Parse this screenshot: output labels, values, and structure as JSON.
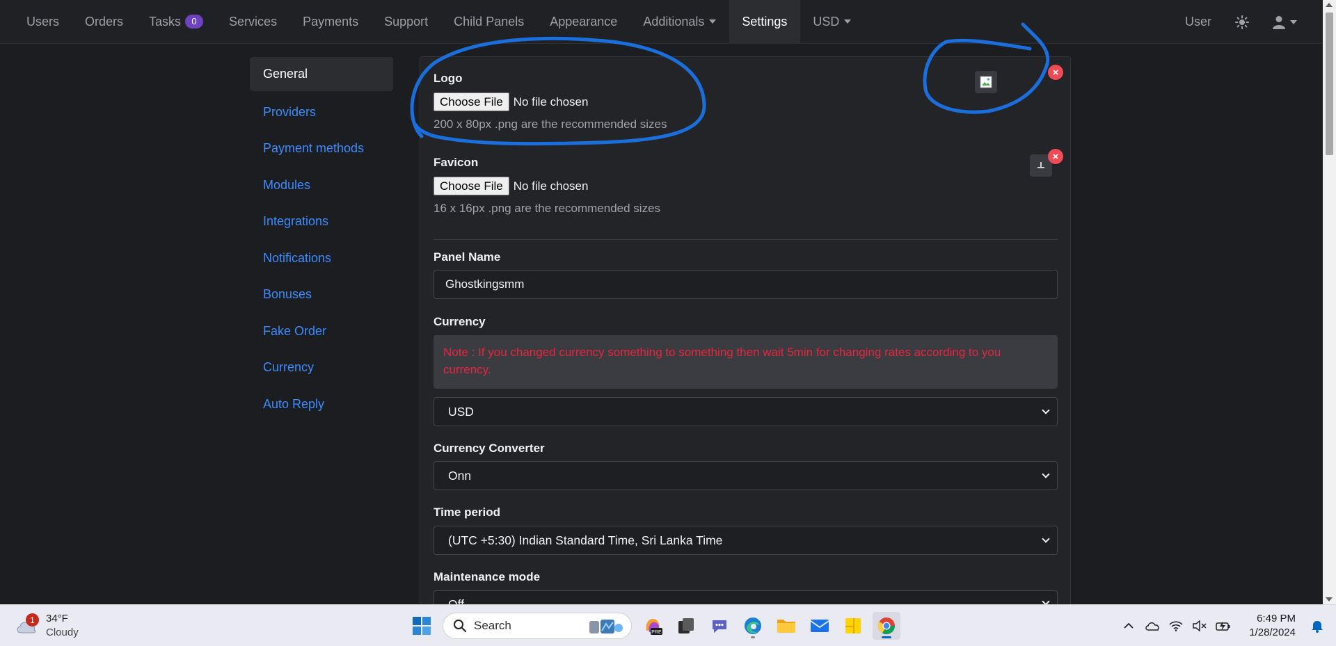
{
  "nav": {
    "items": [
      {
        "label": "Users"
      },
      {
        "label": "Orders"
      },
      {
        "label": "Tasks",
        "badge": "0"
      },
      {
        "label": "Services"
      },
      {
        "label": "Payments"
      },
      {
        "label": "Support"
      },
      {
        "label": "Child Panels"
      },
      {
        "label": "Appearance"
      },
      {
        "label": "Additionals"
      },
      {
        "label": "Settings"
      },
      {
        "label": "USD"
      }
    ],
    "active": "Settings",
    "right_user": "User"
  },
  "sidebar": {
    "items": [
      {
        "label": "General"
      },
      {
        "label": "Providers"
      },
      {
        "label": "Payment methods"
      },
      {
        "label": "Modules"
      },
      {
        "label": "Integrations"
      },
      {
        "label": "Notifications"
      },
      {
        "label": "Bonuses"
      },
      {
        "label": "Fake Order"
      },
      {
        "label": "Currency"
      },
      {
        "label": "Auto Reply"
      }
    ]
  },
  "form": {
    "logo": {
      "label": "Logo",
      "button": "Choose File",
      "status": "No file chosen",
      "hint": "200 x 80px .png are the recommended sizes"
    },
    "favicon": {
      "label": "Favicon",
      "button": "Choose File",
      "status": "No file chosen",
      "hint": "16 x 16px .png are the recommended sizes"
    },
    "panel_name": {
      "label": "Panel Name",
      "value": "Ghostkingsmm"
    },
    "currency": {
      "label": "Currency",
      "note": "Note : If you changed currency something to something then wait 5min for changing rates according to you currency.",
      "value": "USD"
    },
    "currency_converter": {
      "label": "Currency Converter",
      "value": "Onn"
    },
    "time_period": {
      "label": "Time period",
      "value": "(UTC +5:30) Indian Standard Time, Sri Lanka Time"
    },
    "maintenance": {
      "label": "Maintenance mode",
      "value": "Off"
    },
    "remove_symbol": "×"
  },
  "taskbar": {
    "weather_temp": "34°F",
    "weather_cond": "Cloudy",
    "weather_badge": "1",
    "search_label": "Search",
    "time": "6:49 PM",
    "date": "1/28/2024"
  },
  "colors": {
    "accent": "#3d8bfd",
    "badge": "#6f42c1",
    "note_text": "#e5263f",
    "remove": "#ef4b56",
    "annotation": "#1a6fdc"
  }
}
